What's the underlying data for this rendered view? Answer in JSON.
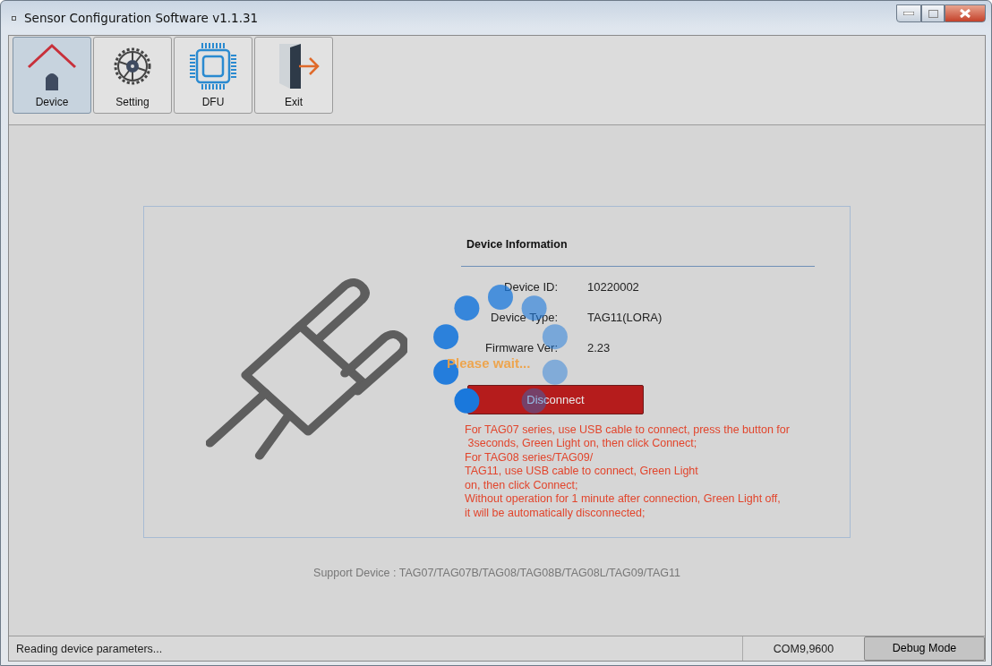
{
  "window": {
    "title": "Sensor Configuration Software v1.1.31"
  },
  "toolbar": [
    {
      "label": "Device",
      "kind": "device",
      "selected": true
    },
    {
      "label": "Setting",
      "kind": "setting",
      "selected": false
    },
    {
      "label": "DFU",
      "kind": "dfu",
      "selected": false
    },
    {
      "label": "Exit",
      "kind": "exit",
      "selected": false
    }
  ],
  "device_info": {
    "title": "Device Information",
    "fields": [
      {
        "label": "Device ID:",
        "value": "10220002"
      },
      {
        "label": "Device Type:",
        "value": "TAG11(LORA)"
      },
      {
        "label": "Firmware Ver:",
        "value": "2.23"
      }
    ]
  },
  "loading": {
    "text": "Please wait..."
  },
  "disconnect_button": {
    "label": "Disconnect"
  },
  "instructions": [
    "For TAG07 series, use USB cable to connect, press the button for",
    " 3seconds, Green Light on, then click Connect;",
    "For TAG08 series/TAG09/",
    "TAG11, use USB cable to connect, Green Light",
    "on, then click Connect;",
    "Without operation for 1 minute after connection, Green Light off,",
    "it will be automatically disconnected;"
  ],
  "support_text": "Support Device : TAG07/TAG07B/TAG08/TAG08B/TAG08L/TAG09/TAG11",
  "status_bar": {
    "message": "Reading device parameters...",
    "port": "COM9,9600",
    "debug_button": "Debug Mode"
  }
}
